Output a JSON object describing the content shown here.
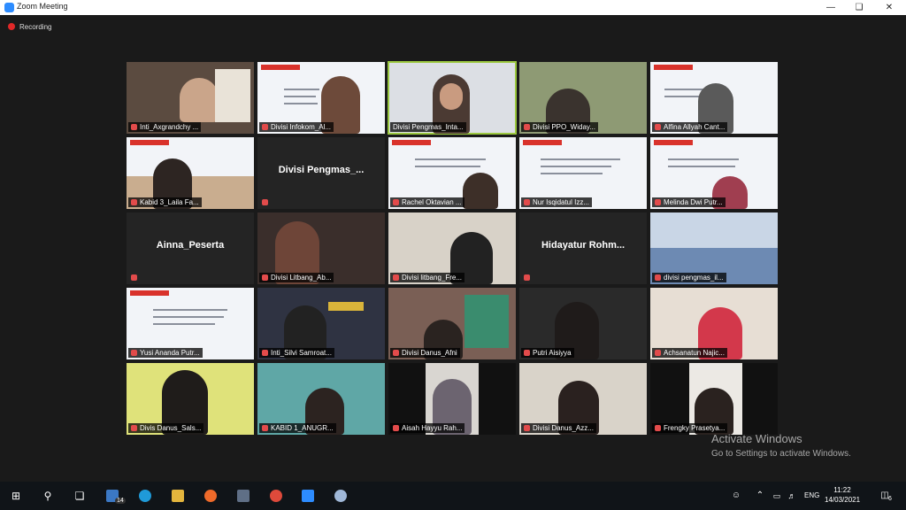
{
  "window": {
    "title": "Zoom Meeting"
  },
  "recording": {
    "label": "Recording"
  },
  "participants": [
    {
      "name": "Inti_Axgrandchy ..."
    },
    {
      "name": "Divisi Infokom_Al..."
    },
    {
      "name": "Divisi Pengmas_Inta..."
    },
    {
      "name": "Divisi PPO_Widay..."
    },
    {
      "name": "Alfina Allyah Cant..."
    },
    {
      "name": "Kabid 3_Laila Fa..."
    },
    {
      "name": "Divisi  Pengmas_..."
    },
    {
      "name": "Rachel  Oktavian ..."
    },
    {
      "name": "Nur  Isqidatul  Izz..."
    },
    {
      "name": "Melinda Dwi Putr..."
    },
    {
      "name": "Ainna_Peserta"
    },
    {
      "name": "Divisi Litbang_Ab..."
    },
    {
      "name": "Divisi  litbang_Fre..."
    },
    {
      "name": "Hidayatur  Rohm..."
    },
    {
      "name": "divisi pengmas_il..."
    },
    {
      "name": "Yusi Ananda Putr..."
    },
    {
      "name": "Inti_Silvi Samroat..."
    },
    {
      "name": "Divisi Danus_Afni"
    },
    {
      "name": "Putri Aisiyya"
    },
    {
      "name": "Achsanatun Najic..."
    },
    {
      "name": "Divis Danus_Sals..."
    },
    {
      "name": "KABID 1_ANUGR..."
    },
    {
      "name": "Aisah Hayyu Rah..."
    },
    {
      "name": "Divisi Danus_Azz..."
    },
    {
      "name": "Frengky Prasetya..."
    }
  ],
  "slide": {
    "tag": "PENDIDIKAN DASAR"
  },
  "watermark": {
    "title": "Activate Windows",
    "subtitle": "Go to Settings to activate Windows."
  },
  "taskbar": {
    "mail_badge": "14",
    "language": "ENG",
    "time": "11:22",
    "date": "14/03/2021",
    "notification_count": "6"
  }
}
